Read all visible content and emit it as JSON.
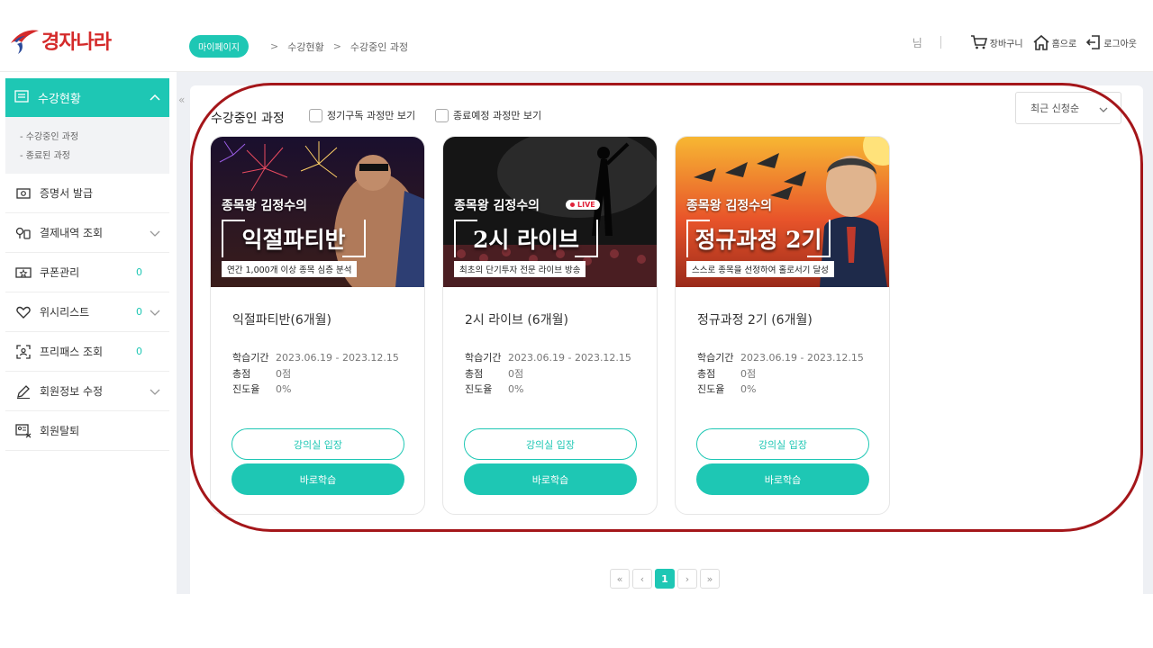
{
  "header": {
    "logo_text": "경자나라",
    "breadcrumb": {
      "pill": "마이페이지",
      "items": [
        "수강현황",
        "수강중인 과정"
      ]
    },
    "user_suffix": "님",
    "links": [
      {
        "label": "장바구니",
        "icon": "cart-icon"
      },
      {
        "label": "홈으로",
        "icon": "home-icon"
      },
      {
        "label": "로그아웃",
        "icon": "logout-icon"
      }
    ]
  },
  "sidebar": {
    "active": {
      "label": "수강현황",
      "icon": "list-icon"
    },
    "sub_items": [
      "- 수강중인 과정",
      "- 종료된 과정"
    ],
    "items": [
      {
        "label": "증명서 발급",
        "icon": "certificate-icon",
        "count": "",
        "chevron": false
      },
      {
        "label": "결제내역 조회",
        "icon": "payment-icon",
        "count": "",
        "chevron": true
      },
      {
        "label": "쿠폰관리",
        "icon": "coupon-icon",
        "count": "0",
        "chevron": false
      },
      {
        "label": "위시리스트",
        "icon": "heart-icon",
        "count": "0",
        "chevron": true
      },
      {
        "label": "프리패스 조회",
        "icon": "freepass-icon",
        "count": "0",
        "chevron": false
      },
      {
        "label": "회원정보 수정",
        "icon": "pencil-icon",
        "count": "",
        "chevron": true
      },
      {
        "label": "회원탈퇴",
        "icon": "withdraw-icon",
        "count": "",
        "chevron": false
      }
    ]
  },
  "main": {
    "section_title": "수강중인 과정",
    "filters": [
      "정기구독 과정만 보기",
      "종료예정 과정만 보기"
    ],
    "sort_label": "최근 신청순",
    "labels": {
      "period": "학습기간",
      "score": "총점",
      "progress": "진도율"
    },
    "courses": [
      {
        "thumb_top": "종목왕 김정수의",
        "thumb_main": "익절파티반",
        "thumb_sub": "연간 1,000개 이상 종목 심층 분석",
        "title": "익절파티반(6개월)",
        "period": "2023.06.19 - 2023.12.15",
        "score": "0점",
        "progress": "0%",
        "enter_label": "강의실 입장",
        "study_label": "바로학습"
      },
      {
        "thumb_top": "종목왕 김정수의",
        "thumb_main": "2시 라이브",
        "thumb_sub": "최초의 단기투자 전문 라이브 방송",
        "live_badge": "LIVE",
        "title": "2시 라이브 (6개월)",
        "period": "2023.06.19 - 2023.12.15",
        "score": "0점",
        "progress": "0%",
        "enter_label": "강의실 입장",
        "study_label": "바로학습"
      },
      {
        "thumb_top": "종목왕 김정수의",
        "thumb_main": "정규과정 2기",
        "thumb_sub": "스스로 종목을 선정하여 홀로서기 달성",
        "title": "정규과정 2기 (6개월)",
        "period": "2023.06.19 - 2023.12.15",
        "score": "0점",
        "progress": "0%",
        "enter_label": "강의실 입장",
        "study_label": "바로학습"
      }
    ]
  },
  "pagination": {
    "first": "«",
    "prev": "‹",
    "current": "1",
    "next": "›",
    "last": "»"
  },
  "colors": {
    "accent": "#1ec7b4",
    "brand_red": "#d42a2a",
    "highlight": "#a4161a"
  }
}
